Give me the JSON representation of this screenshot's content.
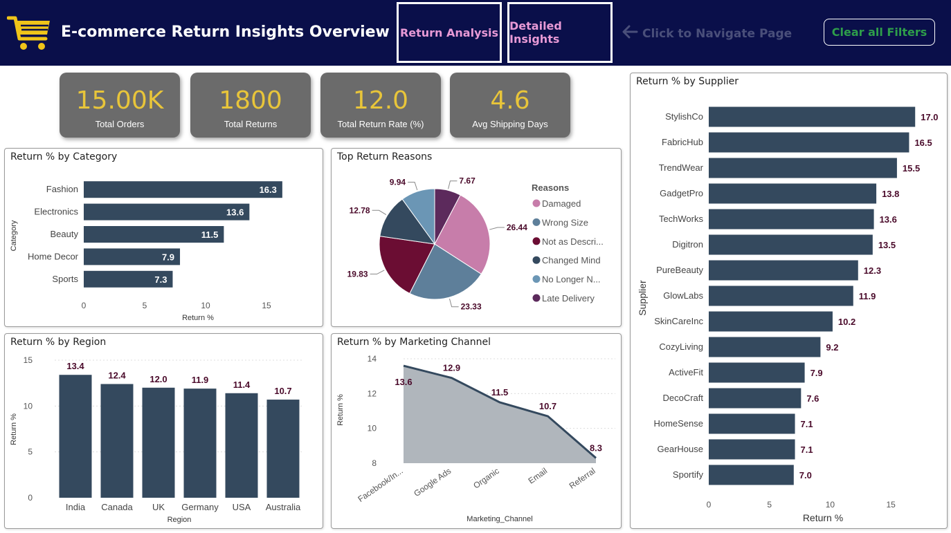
{
  "header": {
    "title": "E-commerce Return Insights Overview",
    "nav_return_analysis": "Return Analysis",
    "nav_detailed_insights": "Detailed Insights",
    "nav_hint": "Click to Navigate Page",
    "clear_filters": "Clear all Filters",
    "colors": {
      "background": "#0a0f4a",
      "nav_text": "#e89ad6",
      "clear_text": "#2e9e4a",
      "logo": "#f0c419"
    }
  },
  "kpis": [
    {
      "value": "15.00K",
      "label": "Total Orders"
    },
    {
      "value": "1800",
      "label": "Total Returns"
    },
    {
      "value": "12.0",
      "label": "Total Return Rate (%)"
    },
    {
      "value": "4.6",
      "label": "Avg Shipping Days"
    }
  ],
  "panels": {
    "category": "Return % by Category",
    "reasons": "Top Return Reasons",
    "region": "Return % by Region",
    "channel": "Return % by Marketing Channel",
    "supplier": "Return % by Supplier"
  },
  "chart_data": [
    {
      "id": "category",
      "type": "bar",
      "orientation": "horizontal",
      "title": "Return % by Category",
      "xlabel": "Return %",
      "ylabel": "Category",
      "categories": [
        "Fashion",
        "Electronics",
        "Beauty",
        "Home Decor",
        "Sports"
      ],
      "values": [
        16.3,
        13.6,
        11.5,
        7.9,
        7.3
      ],
      "xlim": [
        0,
        17.5
      ],
      "ticks": [
        0,
        5,
        10,
        15
      ],
      "label_position": "inside",
      "color": "#34495e"
    },
    {
      "id": "reasons",
      "type": "pie",
      "title": "Top Return Reasons",
      "legend_title": "Reasons",
      "legend_position": "right",
      "slices": [
        {
          "legend": "Damaged",
          "value": 26.44,
          "color": "#c77daa"
        },
        {
          "legend": "Wrong Size",
          "value": 23.33,
          "color": "#5e7f9a"
        },
        {
          "legend": "Not as Descri...",
          "value": 19.83,
          "color": "#6b0d33"
        },
        {
          "legend": "Changed Mind",
          "value": 12.78,
          "color": "#34495e"
        },
        {
          "legend": "No Longer N...",
          "value": 9.94,
          "color": "#6b96b5"
        },
        {
          "legend": "Late Delivery",
          "value": 7.67,
          "color": "#5c2a5c"
        }
      ]
    },
    {
      "id": "region",
      "type": "bar",
      "orientation": "vertical",
      "title": "Return % by Region",
      "xlabel": "Region",
      "ylabel": "Return %",
      "categories": [
        "India",
        "Canada",
        "UK",
        "Germany",
        "USA",
        "Australia"
      ],
      "values": [
        13.4,
        12.4,
        12.0,
        11.9,
        11.4,
        10.7
      ],
      "ylim": [
        0,
        15
      ],
      "ticks": [
        0,
        5,
        10,
        15
      ],
      "grid": true,
      "color": "#34495e"
    },
    {
      "id": "channel",
      "type": "area",
      "title": "Return % by Marketing Channel",
      "xlabel": "Marketing_Channel",
      "ylabel": "Return %",
      "categories": [
        "Facebook/In...",
        "Google Ads",
        "Organic",
        "Email",
        "Referral"
      ],
      "values": [
        13.6,
        12.9,
        11.5,
        10.7,
        8.3
      ],
      "ylim": [
        8,
        14
      ],
      "ticks": [
        8,
        10,
        12,
        14
      ],
      "grid": true,
      "fill": "#b0b6bc",
      "line": "#34495e"
    },
    {
      "id": "supplier",
      "type": "bar",
      "orientation": "horizontal",
      "title": "Return % by Supplier",
      "xlabel": "Return %",
      "ylabel": "Supplier",
      "categories": [
        "StylishCo",
        "FabricHub",
        "TrendWear",
        "GadgetPro",
        "TechWorks",
        "Digitron",
        "PureBeauty",
        "GlowLabs",
        "SkinCareInc",
        "CozyLiving",
        "ActiveFit",
        "DecoCraft",
        "HomeSense",
        "GearHouse",
        "Sportify"
      ],
      "values": [
        17.0,
        16.5,
        15.5,
        13.8,
        13.6,
        13.5,
        12.3,
        11.9,
        10.2,
        9.2,
        7.9,
        7.6,
        7.1,
        7.1,
        7.0
      ],
      "xlim": [
        0,
        17.5
      ],
      "ticks": [
        0,
        5,
        10,
        15
      ],
      "label_position": "outside",
      "color": "#34495e"
    }
  ]
}
